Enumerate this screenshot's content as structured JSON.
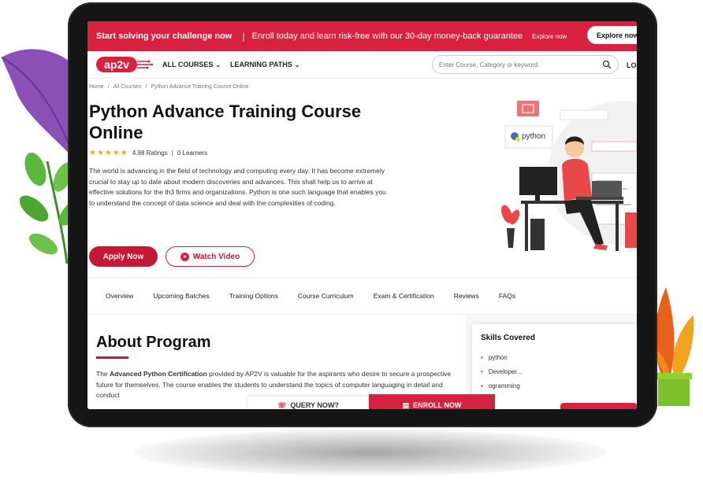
{
  "promo": {
    "headline": "Start solving your challenge now",
    "separator": "|",
    "offer": "Enroll today and learn risk-free with our 30-day money-back guarantee",
    "explore_small": "Explore now",
    "explore_button": "Explore now"
  },
  "nav": {
    "logo_text": "ap2v",
    "all_courses": "ALL COURSES",
    "learning_paths": "LEARNING PATHS",
    "search_placeholder": "Enter Course, Category or keyword",
    "login": "LOG"
  },
  "breadcrumb": {
    "home": "Home",
    "all_courses": "All Courses",
    "current": "Python Advance Training Course Online",
    "sep": "/"
  },
  "hero": {
    "title": "Python Advance Training Course Online",
    "stars": "★★★★★",
    "ratings": "4.98 Ratings",
    "divider": "|",
    "learners": "0 Learners",
    "description": "The world is advancing in the field of technology and computing every day. It has become extremely crucial to stay up to date about modern discoveries and advances. This shall help us to arrive at effective solutions for the th3 firms and organizations. Python is one such language that enables you to understand the concept of data science and deal with the complexities of coding.",
    "apply_label": "Apply Now",
    "watch_label": "Watch Video",
    "illustration_label": "python"
  },
  "tabs": [
    "Overview",
    "Upcoming Batches",
    "Training Options",
    "Course Curriculum",
    "Exam & Certification",
    "Reviews",
    "FAQs"
  ],
  "about": {
    "title": "About Program",
    "text_bold": "Advanced Python Certification",
    "text_pre": "The ",
    "text_post": " provided by AP2V is valuable for the aspirants who desire to secure a prospective future for themselves. The course enables the students to understand the topics of computer languaging in detail and conduct"
  },
  "skills": {
    "title": "Skills Covered",
    "items": [
      "python",
      "Developer...",
      "ogramming"
    ]
  },
  "bottom_bar": {
    "query": "QUERY NOW?",
    "enroll": "ENROLL NOW"
  },
  "colors": {
    "brand_red": "#d7213f",
    "dark_red": "#c41837",
    "star": "#f5a623"
  }
}
